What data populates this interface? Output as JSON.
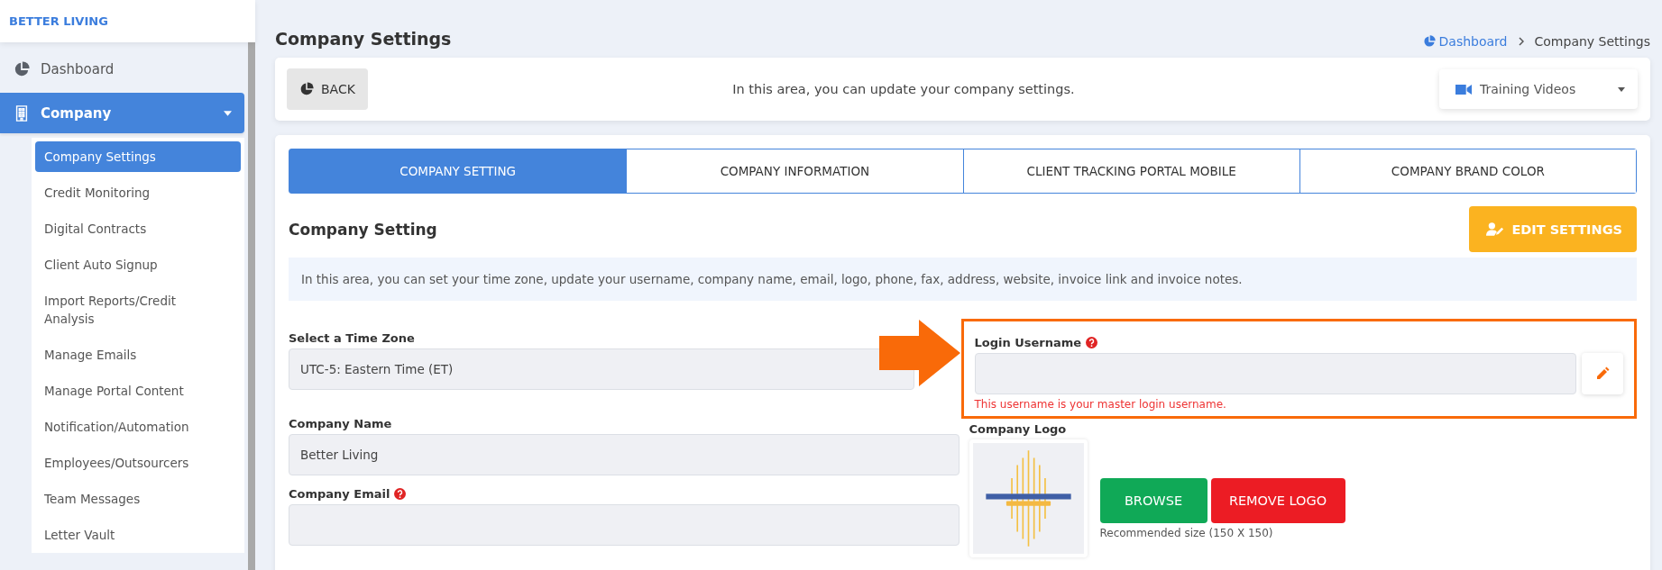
{
  "brand": "BETTER LIVING",
  "sidebar": {
    "items": [
      {
        "label": "Dashboard",
        "selected": false
      },
      {
        "label": "Company",
        "selected": true,
        "expanded": true,
        "children": [
          {
            "label": "Company Settings",
            "selected": true
          },
          {
            "label": "Credit Monitoring",
            "selected": false
          },
          {
            "label": "Digital Contracts",
            "selected": false
          },
          {
            "label": "Client Auto Signup",
            "selected": false
          },
          {
            "label": "Import Reports/Credit Analysis",
            "selected": false
          },
          {
            "label": "Manage Emails",
            "selected": false
          },
          {
            "label": "Manage Portal Content",
            "selected": false
          },
          {
            "label": "Notification/Automation",
            "selected": false
          },
          {
            "label": "Employees/Outsourcers",
            "selected": false
          },
          {
            "label": "Team Messages",
            "selected": false
          },
          {
            "label": "Letter Vault",
            "selected": false
          }
        ]
      }
    ]
  },
  "page_title": "Company Settings",
  "breadcrumb": [
    {
      "label": "Dashboard"
    },
    {
      "label": "Company Settings"
    }
  ],
  "toolbar": {
    "back": "BACK",
    "notice": "In this area, you can update your company settings.",
    "videos": "Training Videos"
  },
  "tabs": [
    {
      "label": "COMPANY SETTING",
      "selected": true
    },
    {
      "label": "COMPANY INFORMATION",
      "selected": false
    },
    {
      "label": "CLIENT TRACKING PORTAL MOBILE",
      "selected": false
    },
    {
      "label": "COMPANY BRAND COLOR",
      "selected": false
    }
  ],
  "section": {
    "heading": "Company Setting",
    "edit_button": "EDIT SETTINGS",
    "info": "In this area, you can set your time zone, update your username, company name, email, logo, phone, fax, address, website, invoice link and invoice notes."
  },
  "time_zone": {
    "label": "Select a Time Zone",
    "value": "UTC-5: Eastern Time (ET)"
  },
  "login_username": {
    "label": "Login Username",
    "help": true,
    "hint": "This username is your master login username.",
    "highlighted": true
  },
  "company_name": {
    "label": "Company Name",
    "value": "Better Living"
  },
  "company_email": {
    "label": "Company Email",
    "help": true
  },
  "company_logo": {
    "label": "Company Logo",
    "browse": "BROWSE",
    "remove": "REMOVE LOGO",
    "recommendation": "Recommended size (150 X 150)"
  }
}
